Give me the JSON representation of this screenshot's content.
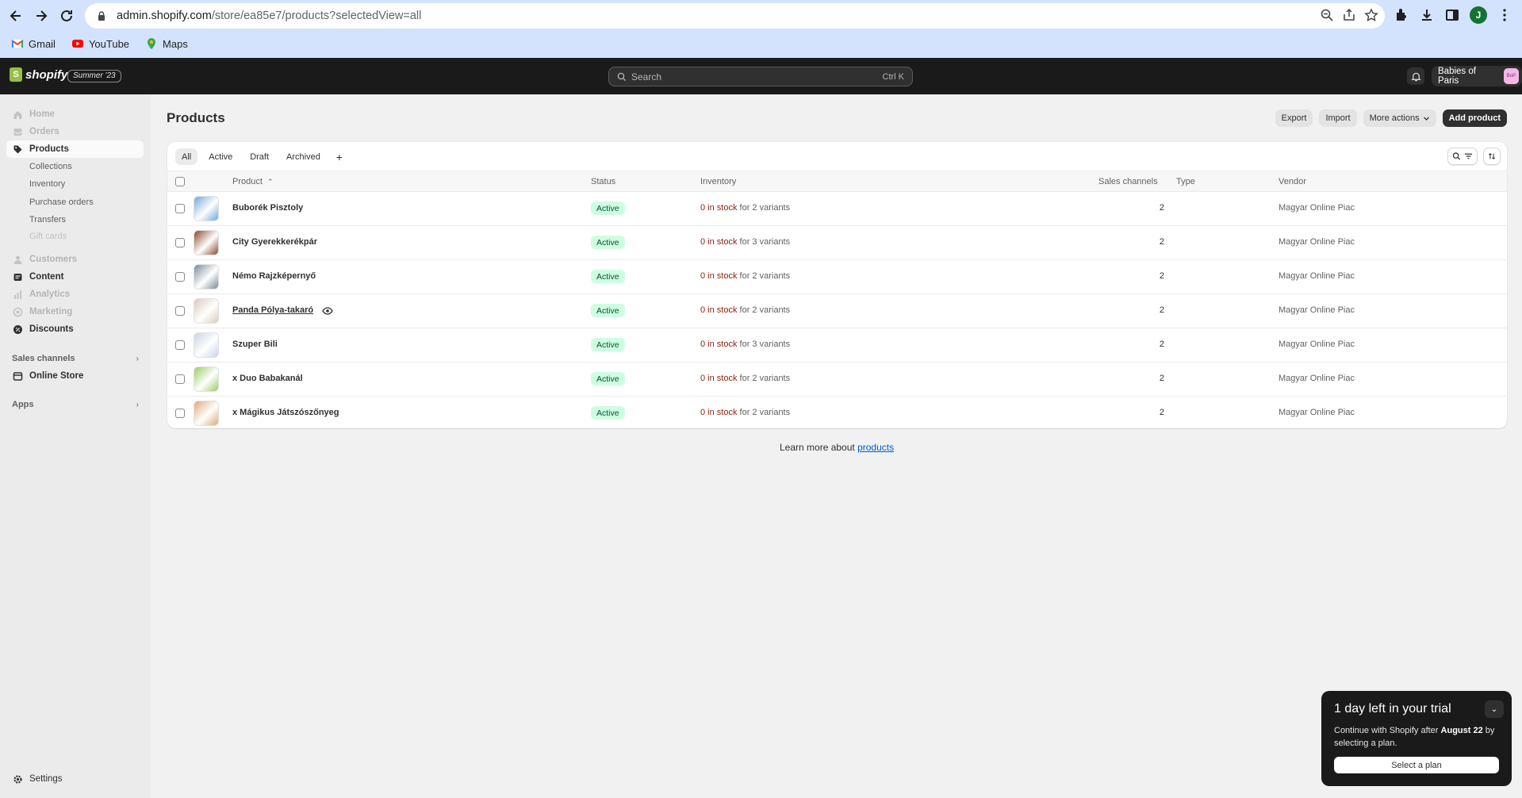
{
  "browser": {
    "url_main": "admin.shopify.com",
    "url_rest": "/store/ea85e7/products?selectedView=all",
    "bookmarks": [
      {
        "label": "Gmail",
        "icon": "gmail-icon"
      },
      {
        "label": "YouTube",
        "icon": "youtube-icon"
      },
      {
        "label": "Maps",
        "icon": "maps-icon"
      }
    ],
    "profile_initial": "J"
  },
  "topbar": {
    "logo_text": "shopify",
    "edition_badge": "Summer '23",
    "search_placeholder": "Search",
    "search_shortcut": "Ctrl K",
    "store_name": "Babies of Paris",
    "store_avatar": "BoP"
  },
  "sidebar": {
    "items": [
      {
        "label": "Home",
        "icon": "home-icon",
        "state": "disabled"
      },
      {
        "label": "Orders",
        "icon": "orders-icon",
        "state": "disabled"
      },
      {
        "label": "Products",
        "icon": "tag-icon",
        "state": "active"
      },
      {
        "label": "Customers",
        "icon": "person-icon",
        "state": "disabled"
      },
      {
        "label": "Content",
        "icon": "content-icon",
        "state": "normal"
      },
      {
        "label": "Analytics",
        "icon": "analytics-icon",
        "state": "disabled"
      },
      {
        "label": "Marketing",
        "icon": "marketing-icon",
        "state": "disabled"
      },
      {
        "label": "Discounts",
        "icon": "discount-icon",
        "state": "normal"
      }
    ],
    "product_subitems": [
      {
        "label": "Collections",
        "state": "normal"
      },
      {
        "label": "Inventory",
        "state": "normal"
      },
      {
        "label": "Purchase orders",
        "state": "normal"
      },
      {
        "label": "Transfers",
        "state": "normal"
      },
      {
        "label": "Gift cards",
        "state": "disabled"
      }
    ],
    "sales_channels_label": "Sales channels",
    "online_store_label": "Online Store",
    "apps_label": "Apps",
    "settings_label": "Settings"
  },
  "page": {
    "title": "Products",
    "export_label": "Export",
    "import_label": "Import",
    "more_actions_label": "More actions",
    "add_product_label": "Add product"
  },
  "tabs": [
    "All",
    "Active",
    "Draft",
    "Archived"
  ],
  "table": {
    "columns": {
      "product": "Product",
      "status": "Status",
      "inventory": "Inventory",
      "sales_channels": "Sales channels",
      "type": "Type",
      "vendor": "Vendor"
    },
    "rows": [
      {
        "name": "Buborék Pisztoly",
        "status": "Active",
        "stock": "0 in stock",
        "variants": "for 2 variants",
        "channels": "2",
        "type": "",
        "vendor": "Magyar Online Piac",
        "thumb": "#6fa8dc"
      },
      {
        "name": "City Gyerekkerékpár",
        "status": "Active",
        "stock": "0 in stock",
        "variants": "for 3 variants",
        "channels": "2",
        "type": "",
        "vendor": "Magyar Online Piac",
        "thumb": "#8b4a2b"
      },
      {
        "name": "Némo Rajzképernyő",
        "status": "Active",
        "stock": "0 in stock",
        "variants": "for 2 variants",
        "channels": "2",
        "type": "",
        "vendor": "Magyar Online Piac",
        "thumb": "#7d8a99"
      },
      {
        "name": "Panda Pólya-takaró",
        "status": "Active",
        "stock": "0 in stock",
        "variants": "for 2 variants",
        "channels": "2",
        "type": "",
        "vendor": "Magyar Online Piac",
        "thumb": "#d9cbbb"
      },
      {
        "name": "Szuper Bili",
        "status": "Active",
        "stock": "0 in stock",
        "variants": "for 3 variants",
        "channels": "2",
        "type": "",
        "vendor": "Magyar Online Piac",
        "thumb": "#c9d3e6"
      },
      {
        "name": "x Duo Babakanál",
        "status": "Active",
        "stock": "0 in stock",
        "variants": "for 2 variants",
        "channels": "2",
        "type": "",
        "vendor": "Magyar Online Piac",
        "thumb": "#9ccc65"
      },
      {
        "name": "x Mágikus Játszószőnyeg",
        "status": "Active",
        "stock": "0 in stock",
        "variants": "for 2 variants",
        "channels": "2",
        "type": "",
        "vendor": "Magyar Online Piac",
        "thumb": "#e0a878"
      }
    ]
  },
  "learn_more": {
    "text": "Learn more about",
    "link": "products"
  },
  "trial": {
    "title": "1 day left in your trial",
    "text_before": "Continue with Shopify after",
    "date": "August 22",
    "text_after": "by selecting a plan.",
    "button": "Select a plan"
  }
}
